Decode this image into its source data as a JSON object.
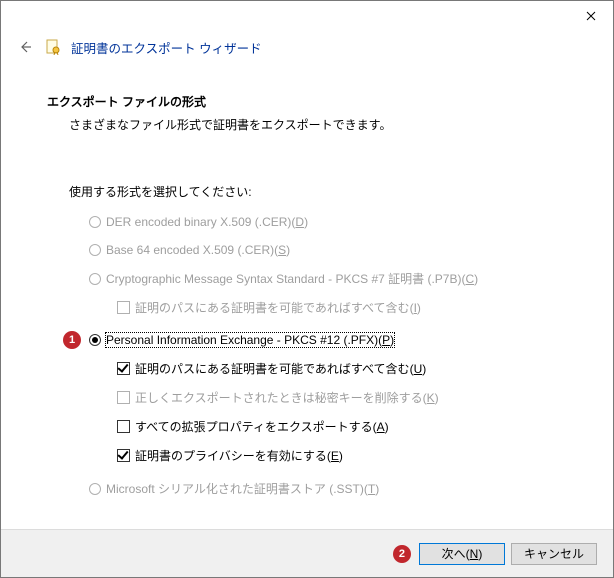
{
  "window": {
    "title": "証明書のエクスポート ウィザード"
  },
  "section": {
    "title": "エクスポート ファイルの形式",
    "description": "さまざまなファイル形式で証明書をエクスポートできます。",
    "prompt": "使用する形式を選択してください:"
  },
  "options": {
    "der": {
      "label": "DER encoded binary X.509 (.CER)",
      "accel": "D",
      "enabled": false,
      "checked": false
    },
    "base64": {
      "label": "Base 64 encoded X.509 (.CER)",
      "accel": "S",
      "enabled": false,
      "checked": false
    },
    "pkcs7": {
      "label": "Cryptographic Message Syntax Standard - PKCS #7 証明書 (.P7B)",
      "accel": "C",
      "enabled": false,
      "checked": false
    },
    "pkcs7_include": {
      "label": "証明のパスにある証明書を可能であればすべて含む",
      "accel": "I",
      "enabled": false,
      "checked": false
    },
    "pfx": {
      "label": "Personal Information Exchange - PKCS #12 (.PFX)",
      "accel": "P",
      "enabled": true,
      "checked": true
    },
    "pfx_include": {
      "label": "証明のパスにある証明書を可能であればすべて含む",
      "accel": "U",
      "enabled": true,
      "checked": true
    },
    "pfx_delete": {
      "label": "正しくエクスポートされたときは秘密キーを削除する",
      "accel": "K",
      "enabled": false,
      "checked": false
    },
    "pfx_extprops": {
      "label": "すべての拡張プロパティをエクスポートする",
      "accel": "A",
      "enabled": true,
      "checked": false
    },
    "pfx_privacy": {
      "label": "証明書のプライバシーを有効にする",
      "accel": "E",
      "enabled": true,
      "checked": true
    },
    "sst": {
      "label": "Microsoft シリアル化された証明書ストア (.SST)",
      "accel": "T",
      "enabled": false,
      "checked": false
    }
  },
  "annotations": {
    "one": "1",
    "two": "2"
  },
  "buttons": {
    "next": "次へ(N)",
    "cancel": "キャンセル"
  }
}
